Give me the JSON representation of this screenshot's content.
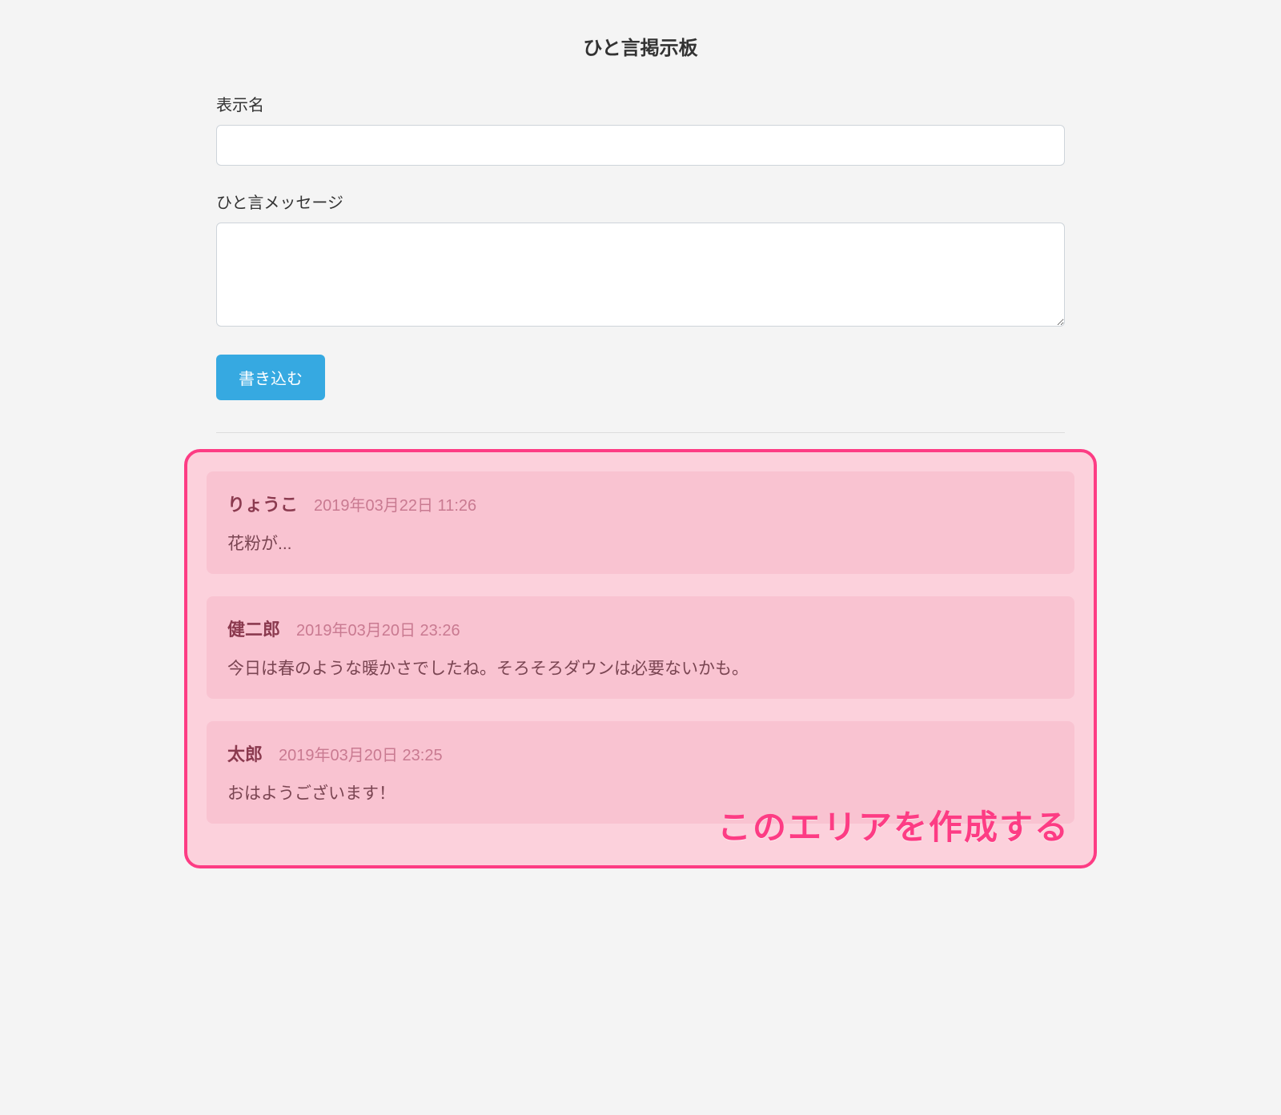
{
  "page": {
    "title": "ひと言掲示板"
  },
  "form": {
    "name_label": "表示名",
    "name_value": "",
    "message_label": "ひと言メッセージ",
    "message_value": "",
    "submit_label": "書き込む"
  },
  "highlight": {
    "caption": "このエリアを作成する"
  },
  "posts": [
    {
      "author": "りょうこ",
      "timestamp": "2019年03月22日 11:26",
      "message": "花粉が..."
    },
    {
      "author": "健二郎",
      "timestamp": "2019年03月20日 23:26",
      "message": "今日は春のような暖かさでしたね。そろそろダウンは必要ないかも。"
    },
    {
      "author": "太郎",
      "timestamp": "2019年03月20日 23:25",
      "message": "おはようございます！"
    }
  ]
}
